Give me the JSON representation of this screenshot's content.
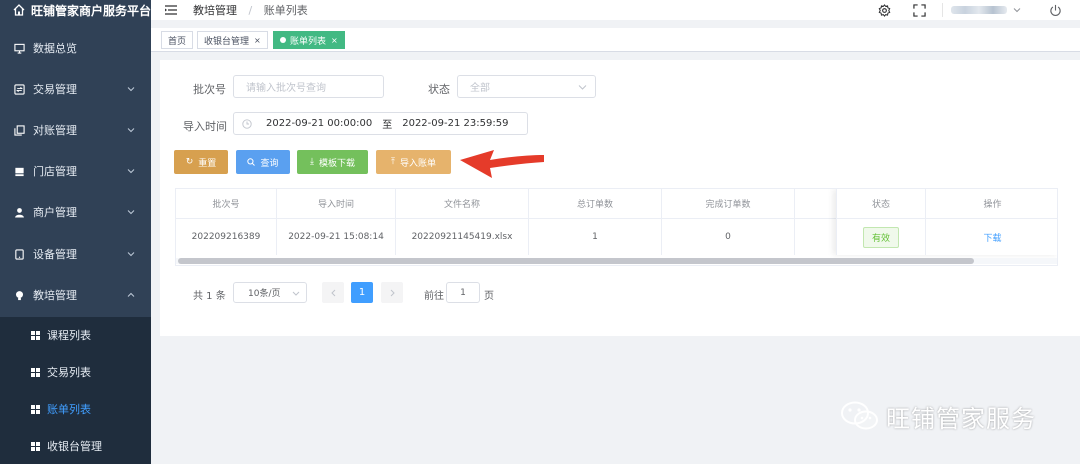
{
  "app": {
    "title": "旺铺管家商户服务平台"
  },
  "sidebar": {
    "items": [
      {
        "label": "数据总览",
        "icon": "monitor-icon"
      },
      {
        "label": "交易管理",
        "icon": "exchange-icon"
      },
      {
        "label": "对账管理",
        "icon": "copy-icon"
      },
      {
        "label": "门店管理",
        "icon": "store-icon"
      },
      {
        "label": "商户管理",
        "icon": "user-icon"
      },
      {
        "label": "设备管理",
        "icon": "tablet-icon"
      },
      {
        "label": "教培管理",
        "icon": "bulb-icon"
      }
    ],
    "sub_items": [
      {
        "label": "课程列表"
      },
      {
        "label": "交易列表"
      },
      {
        "label": "账单列表"
      },
      {
        "label": "收银台管理"
      }
    ]
  },
  "topbar": {
    "breadcrumb": [
      "教培管理",
      "账单列表"
    ],
    "separator": "/"
  },
  "tags": [
    {
      "label": "首页",
      "closable": ""
    },
    {
      "label": "收银台管理",
      "closable": "×"
    },
    {
      "label": "账单列表",
      "closable": "×"
    }
  ],
  "filters": {
    "batch_label": "批次号",
    "batch_placeholder": "请输入批次号查询",
    "status_label": "状态",
    "status_value": "全部",
    "time_label": "导入时间",
    "time_start": "2022-09-21 00:00:00",
    "time_sep": "至",
    "time_end": "2022-09-21 23:59:59"
  },
  "buttons": {
    "reset": "重置",
    "search": "查询",
    "template": "模板下载",
    "import": "导入账单"
  },
  "colors": {
    "reset": "#d7a04f",
    "search": "#5aa0f0",
    "template": "#74c05c",
    "import": "#e6b36c",
    "sidebar": "#304156",
    "annotation": "#e53b2a"
  },
  "table": {
    "headers": [
      "批次号",
      "导入时间",
      "文件名称",
      "总订单数",
      "完成订单数",
      "",
      "状态",
      "操作"
    ],
    "rows": [
      {
        "batch": "202209216389",
        "time": "2022-09-21 15:08:14",
        "file": "20220921145419.xlsx",
        "total": "1",
        "done": "0",
        "status": "有效",
        "action": "下载"
      }
    ]
  },
  "pagination": {
    "total": "共 1 条",
    "page_size": "10条/页",
    "current": "1",
    "goto": "前往",
    "goto_value": "1",
    "unit": "页"
  },
  "watermark": "旺铺管家服务"
}
